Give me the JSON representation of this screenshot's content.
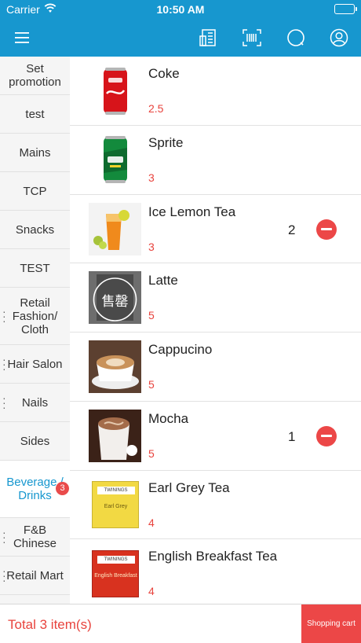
{
  "status_bar": {
    "carrier": "Carrier",
    "time": "10:50 AM"
  },
  "nav": {
    "icons": [
      "menu-icon",
      "receipt-icon",
      "scan-icon",
      "search-icon",
      "user-icon"
    ]
  },
  "categories": [
    {
      "label": "Set promotion",
      "active": false
    },
    {
      "label": "test",
      "active": false
    },
    {
      "label": "Mains",
      "active": false
    },
    {
      "label": "TCP",
      "active": false
    },
    {
      "label": "Snacks",
      "active": false
    },
    {
      "label": "TEST",
      "active": false
    },
    {
      "label": "Retail Fashion/ Cloth",
      "active": false
    },
    {
      "label": "Hair Salon",
      "active": false
    },
    {
      "label": "Nails",
      "active": false
    },
    {
      "label": "Sides",
      "active": false
    },
    {
      "label": "Beverage / Drinks",
      "active": true,
      "badge": "3"
    },
    {
      "label": "F&B Chinese",
      "active": false
    },
    {
      "label": "Retail Mart",
      "active": false
    }
  ],
  "products": [
    {
      "name": "Coke",
      "price": "2.5",
      "qty": null,
      "image": "coke-can"
    },
    {
      "name": "Sprite",
      "price": "3",
      "qty": null,
      "image": "sprite-can"
    },
    {
      "name": "Ice Lemon Tea",
      "price": "3",
      "qty": "2",
      "image": "ice-lemon-tea"
    },
    {
      "name": "Latte",
      "price": "5",
      "qty": null,
      "image": "sold-out-latte"
    },
    {
      "name": "Cappucino",
      "price": "5",
      "qty": null,
      "image": "cappuccino-cup"
    },
    {
      "name": "Mocha",
      "price": "5",
      "qty": "1",
      "image": "mocha-cup"
    },
    {
      "name": "Earl Grey Tea",
      "price": "4",
      "qty": null,
      "image": "earl-grey-box"
    },
    {
      "name": "English Breakfast Tea",
      "price": "4",
      "qty": null,
      "image": "english-breakfast-box"
    }
  ],
  "product_image_text": {
    "sold_out": "售罄",
    "twinings": "TWININGS",
    "earl_grey": "Earl Grey",
    "english_breakfast": "English Breakfast"
  },
  "footer": {
    "total": "Total 3 item(s)",
    "cart_label": "Shopping cart"
  },
  "colors": {
    "primary": "#1797cf",
    "accent": "#ec4747",
    "price": "#e8433d"
  }
}
